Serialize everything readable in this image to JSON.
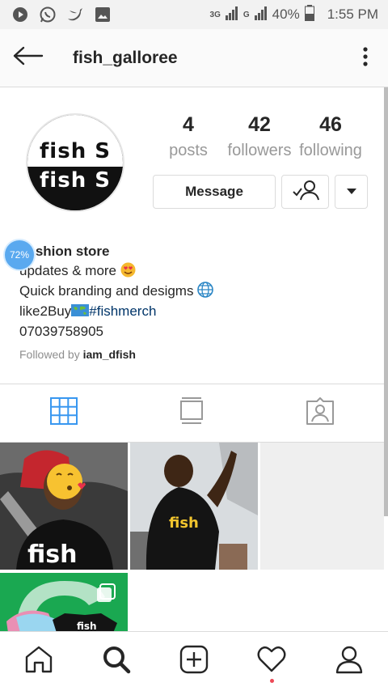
{
  "status_bar": {
    "network_1": "3G",
    "network_2": "G",
    "battery": "40%",
    "time": "1:55 PM",
    "icons": [
      "play-icon",
      "whatsapp-icon",
      "twitter-icon",
      "gallery-icon"
    ]
  },
  "header": {
    "username": "fish_galloree"
  },
  "profile": {
    "avatar_text_top": "fish S",
    "avatar_text_bottom": "fish S",
    "stats": {
      "posts_count": "4",
      "posts_label": "posts",
      "followers_count": "42",
      "followers_label": "followers",
      "following_count": "46",
      "following_label": "following"
    },
    "message_label": "Message"
  },
  "bio": {
    "name": "Fashion store",
    "line1": "updates & more",
    "line2": "Quick branding and desigms",
    "line3_prefix": "like2Buy",
    "line3_tag": "#fishmerch",
    "phone": "07039758905",
    "followed_by_prefix": "Followed by ",
    "followed_by_user": "iam_dfish"
  },
  "overlay": {
    "progress_percent": "72%"
  },
  "posts": {
    "brand_text": "fish"
  },
  "colors": {
    "accent_blue": "#3897f0",
    "tag_blue": "#003569",
    "notification_red": "#ed4956"
  }
}
